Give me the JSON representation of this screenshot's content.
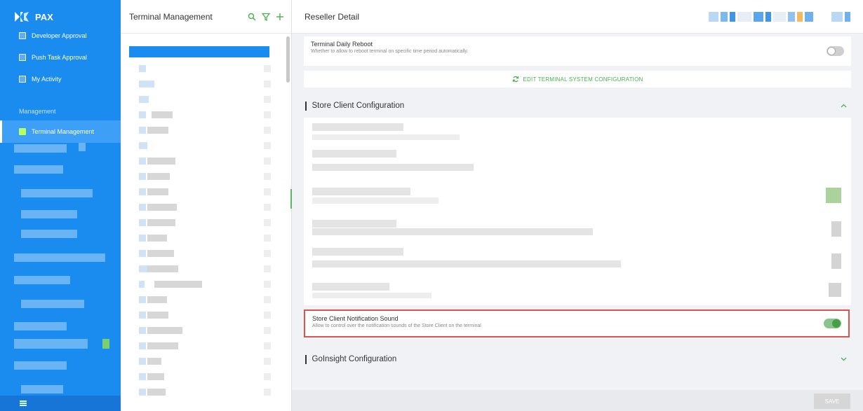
{
  "sidebar": {
    "logo_text": "PAX",
    "items": [
      {
        "label": "Developer Approval"
      },
      {
        "label": "Push Task Approval"
      },
      {
        "label": "My Activity"
      }
    ],
    "section_label": "Management",
    "active_item": {
      "label": "Terminal Management"
    }
  },
  "terminal_panel": {
    "title": "Terminal Management"
  },
  "detail": {
    "title": "Reseller Detail",
    "daily_reboot": {
      "title": "Terminal Daily Reboot",
      "description": "Whether to allow to reboot terminal on specific time period automatically.",
      "enabled": false
    },
    "edit_button_label": "EDIT TERMINAL SYSTEM CONFIGURATION",
    "store_client_section": "Store Client Configuration",
    "notification_sound": {
      "title": "Store Client Notification Sound",
      "description": "Allow to control over the notification sounds of the Store Client on the terminal",
      "enabled": true
    },
    "goinsight_section": "GoInsight Configuration",
    "save_label": "SAVE"
  },
  "colors": {
    "sidebar": "#1a8cf0",
    "accent": "#4caf50",
    "highlight": "#d9534f"
  }
}
